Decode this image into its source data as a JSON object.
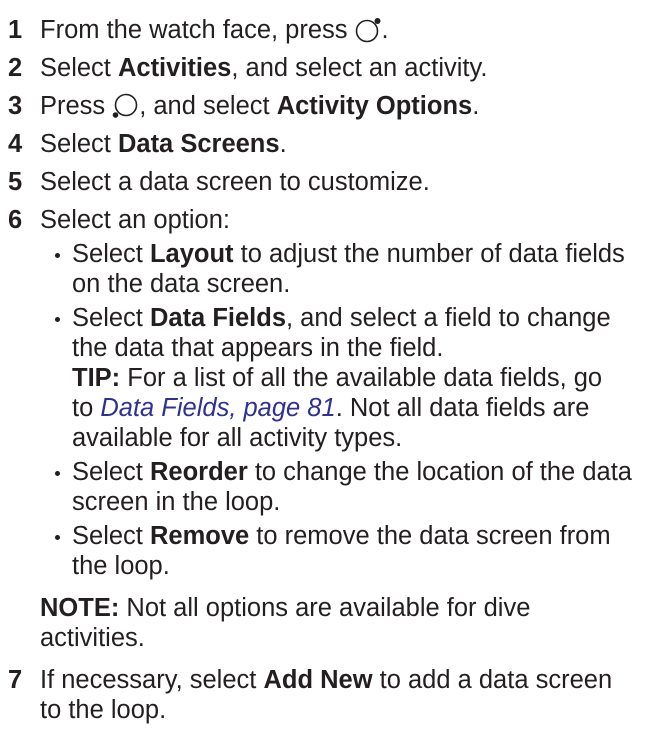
{
  "colors": {
    "text": "#231f20",
    "link": "#2e3192"
  },
  "icons": {
    "step_1_button": "watch-button-icon",
    "step_3_button": "watch-button-icon"
  },
  "steps": {
    "s1": {
      "num": "1",
      "text": "From the watch face, press",
      "end": "."
    },
    "s2": {
      "num": "2",
      "pre": "Select ",
      "bold": "Activities",
      "post": ", and select an activity."
    },
    "s3": {
      "num": "3",
      "pre": "Press",
      "post": ", and select ",
      "bold": "Activity Options",
      "end": "."
    },
    "s4": {
      "num": "4",
      "pre": "Select ",
      "bold": "Data Screens",
      "end": "."
    },
    "s5": {
      "num": "5",
      "text": "Select a data screen to customize."
    },
    "s6": {
      "num": "6",
      "text": "Select an option:"
    },
    "s7": {
      "num": "7",
      "pre": "If necessary, select ",
      "bold": "Add New",
      "post": " to add a data screen",
      "cont": "to the loop."
    }
  },
  "options": [
    {
      "pre": "Select ",
      "bold": "Layout",
      "post": " to adjust the number of data fields",
      "cont": "on the data screen."
    },
    {
      "pre": "Select ",
      "bold": "Data Fields",
      "post": ", and select a field to change",
      "cont": "the data that appears in the field."
    },
    {
      "pre": "Select ",
      "bold": "Reorder",
      "post": " to change the location of the data",
      "cont": "screen in the loop."
    },
    {
      "pre": "Select ",
      "bold": "Remove",
      "post": " to remove the data screen from",
      "cont": "the loop."
    }
  ],
  "tip": {
    "label": "TIP:",
    "line1": " For a list of all the available data fields, go",
    "line2_pre": "to ",
    "link": "Data Fields, page 81",
    "line2_post": ". Not all data fields are",
    "line3": "available for all activity types."
  },
  "note": {
    "label": "NOTE:",
    "line1": " Not all options are available for dive",
    "line2": "activities."
  }
}
